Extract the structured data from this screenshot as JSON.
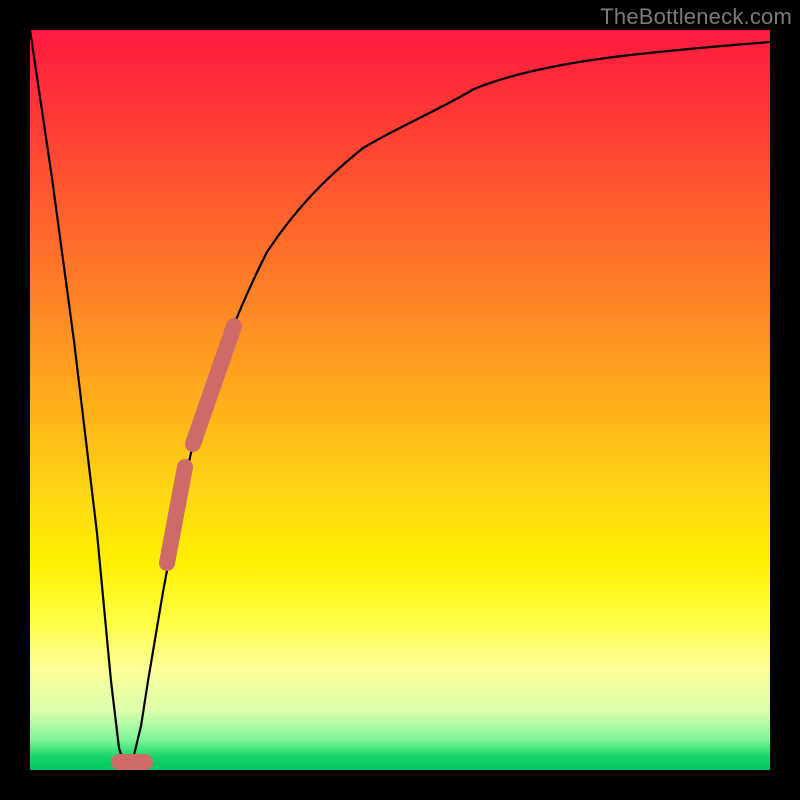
{
  "watermark": "TheBottleneck.com",
  "chart_data": {
    "type": "line",
    "title": "",
    "xlabel": "",
    "ylabel": "",
    "xlim": [
      0,
      100
    ],
    "ylim": [
      0,
      100
    ],
    "grid": false,
    "series": [
      {
        "name": "bottleneck-curve",
        "x": [
          0,
          3,
          6,
          9,
          11,
          12,
          13,
          14,
          15,
          16,
          18,
          20,
          22,
          25,
          28,
          32,
          36,
          40,
          45,
          50,
          56,
          62,
          70,
          78,
          86,
          94,
          100
        ],
        "y": [
          100,
          80,
          58,
          32,
          12,
          3,
          0,
          2,
          6,
          12,
          24,
          35,
          44,
          54,
          62,
          70,
          76,
          80,
          84,
          87,
          89.5,
          91,
          92.5,
          93.5,
          94.2,
          94.8,
          95.2
        ]
      }
    ],
    "markers": [
      {
        "name": "highlight-segment-upper",
        "x": [
          22,
          27.5
        ],
        "y": [
          44,
          60
        ]
      },
      {
        "name": "highlight-segment-lower",
        "x": [
          18.5,
          21
        ],
        "y": [
          28,
          41
        ]
      },
      {
        "name": "highlight-bottom",
        "x": [
          12,
          15.5
        ],
        "y": [
          1,
          1
        ]
      }
    ],
    "colors": {
      "curve": "#000000",
      "marker": "#cc6b69",
      "gradient_top": "#ff1a3f",
      "gradient_bottom": "#00c25e"
    }
  }
}
